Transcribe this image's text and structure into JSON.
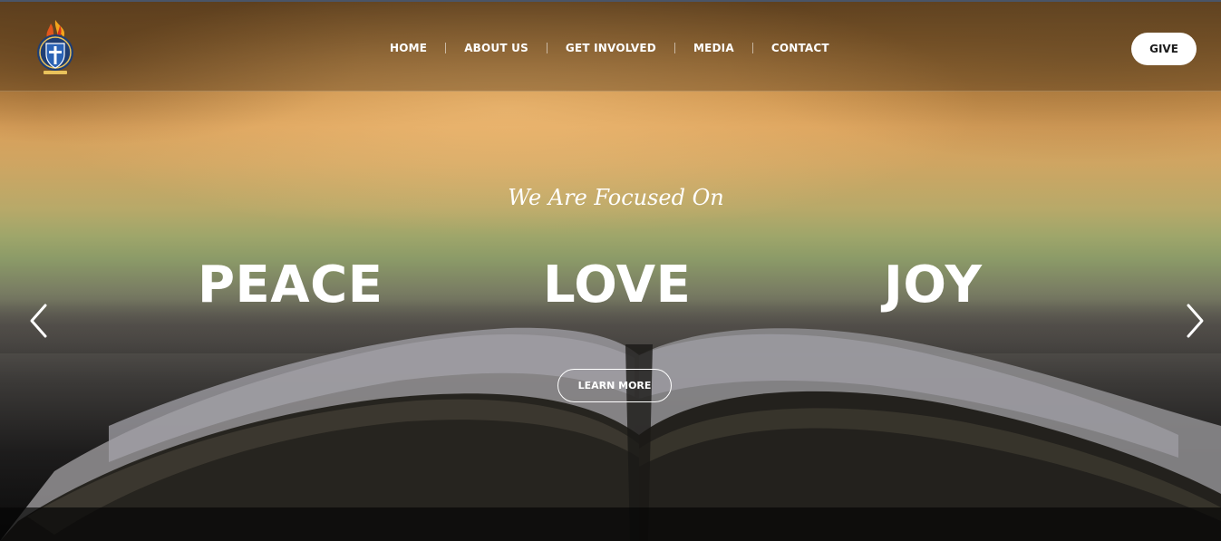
{
  "header": {
    "logo_icon": "church-shield-flame-logo",
    "nav": [
      {
        "label": "HOME"
      },
      {
        "label": "ABOUT US"
      },
      {
        "label": "GET INVOLVED"
      },
      {
        "label": "MEDIA"
      },
      {
        "label": "CONTACT"
      }
    ],
    "give_label": "GIVE"
  },
  "hero": {
    "tagline": "We Are Focused On",
    "words": [
      "PEACE",
      "LOVE",
      "JOY"
    ],
    "cta_label": "LEARN MORE",
    "prev_icon": "chevron-left-icon",
    "next_icon": "chevron-right-icon",
    "background_image": "open-bible-on-table"
  },
  "colors": {
    "header_top_line": "#4a5568",
    "text": "#ffffff",
    "give_button_bg": "#ffffff",
    "give_button_text": "#1b1b1b"
  }
}
